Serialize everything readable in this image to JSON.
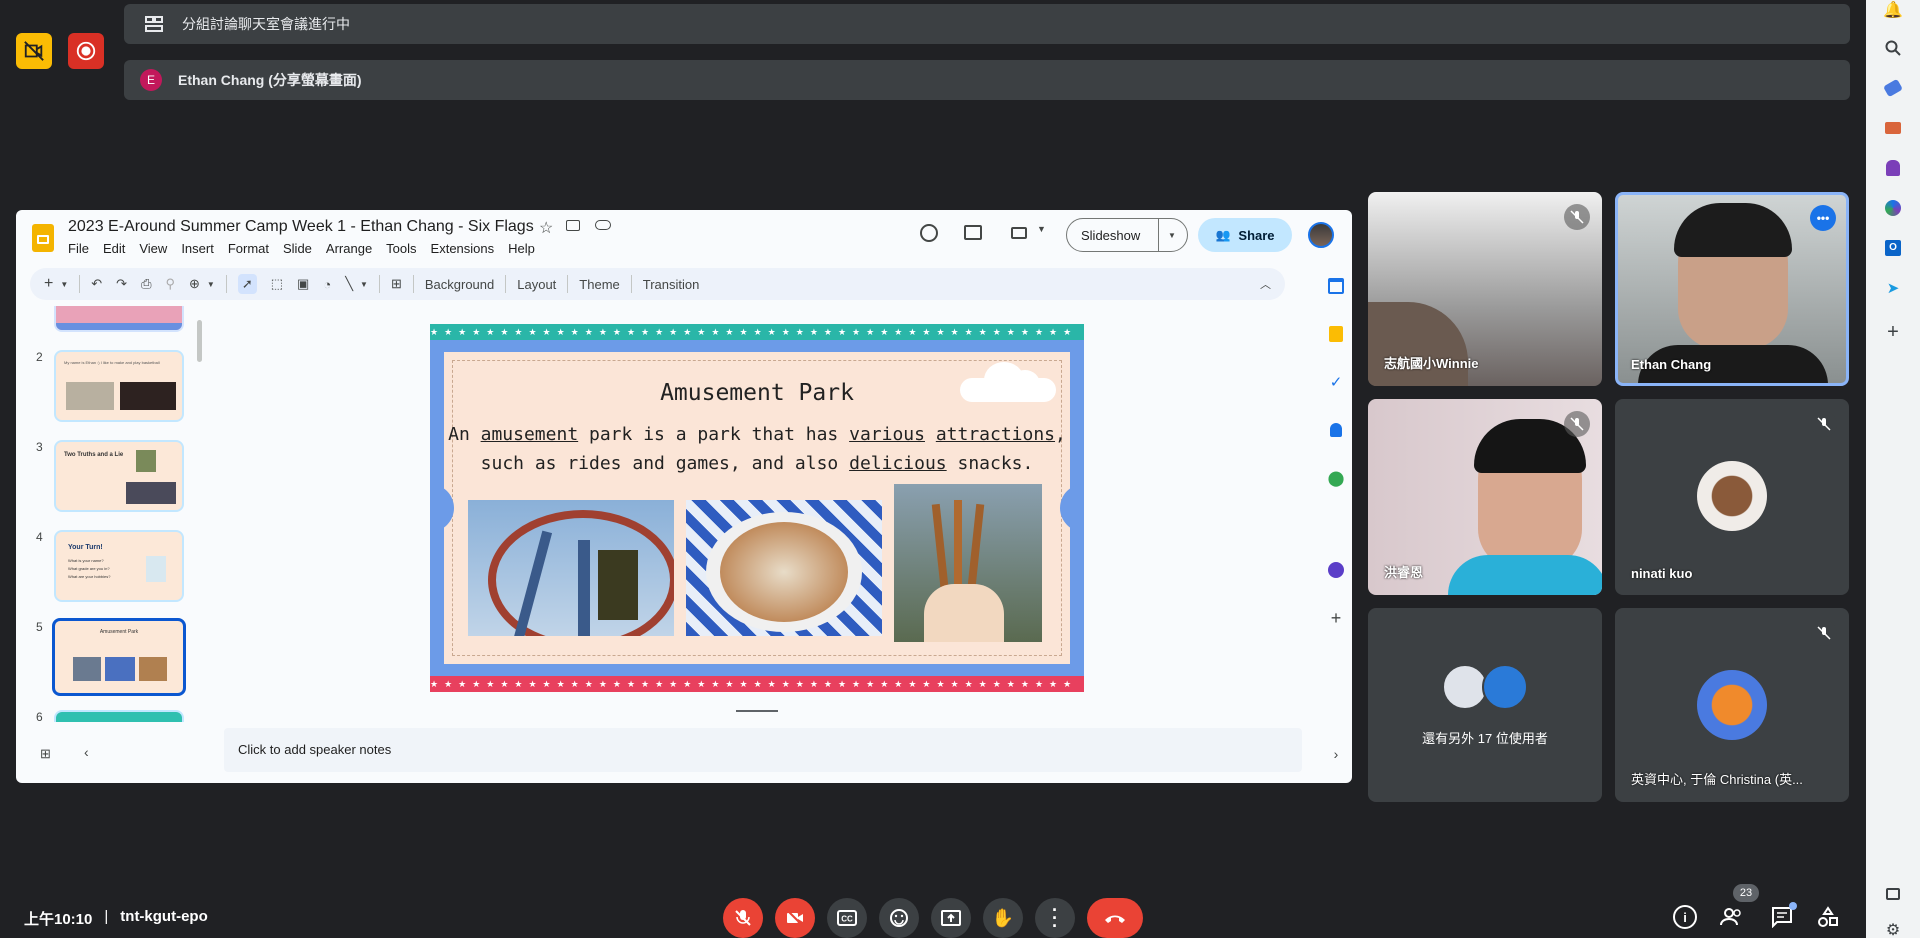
{
  "banners": {
    "breakout": "分組討論聊天室會議進行中",
    "presenter_initial": "E",
    "presenter": "Ethan Chang (分享螢幕畫面)"
  },
  "slides_app": {
    "doc_title": "2023 E-Around Summer Camp Week 1 - Ethan Chang - Six Flags",
    "menu": [
      "File",
      "Edit",
      "View",
      "Insert",
      "Format",
      "Slide",
      "Arrange",
      "Tools",
      "Extensions",
      "Help"
    ],
    "slideshow_label": "Slideshow",
    "share_label": "Share",
    "toolbar": {
      "background": "Background",
      "layout": "Layout",
      "theme": "Theme",
      "transition": "Transition"
    },
    "thumb_numbers": [
      "2",
      "3",
      "4",
      "5",
      "6"
    ],
    "thumb_text": {
      "t2": "My name is Ethan :) I like to make and play basketball",
      "t3": "Two Truths and a Lie",
      "t4": "Your Turn!",
      "t4a": "What is your name?",
      "t4b": "What grade are you in?",
      "t4c": "What are your hobbies?",
      "t5": "Amusement Park"
    },
    "slide": {
      "title": "Amusement Park",
      "body_1": "An ",
      "w_amusement": "amusement",
      "body_2": " park is a park that has ",
      "w_various": "various",
      "w_attractions": "attractions",
      "body_3": ",",
      "body_4": "such as rides and games, and also ",
      "w_delicious": "delicious",
      "body_5": " snacks."
    },
    "speaker_notes": "Click to add speaker notes"
  },
  "participants": [
    {
      "name": "志航國小Winnie",
      "muted": true
    },
    {
      "name": "Ethan Chang",
      "muted": false
    },
    {
      "name": "洪睿恩",
      "muted": true
    },
    {
      "name": "ninati kuo",
      "muted": true
    },
    {
      "name": "還有另外 17 位使用者",
      "muted": false
    },
    {
      "name": "英資中心, 于倫 Christina (英...",
      "muted": true
    }
  ],
  "bottom": {
    "time": "上午10:10",
    "separator": "|",
    "meeting_code": "tnt-kgut-epo",
    "people_count": "23"
  },
  "colors": {
    "accent_blue": "#8ab4f8",
    "end_call_red": "#ea4335",
    "banner_yellow": "#fbbc04",
    "record_red": "#d93025"
  }
}
